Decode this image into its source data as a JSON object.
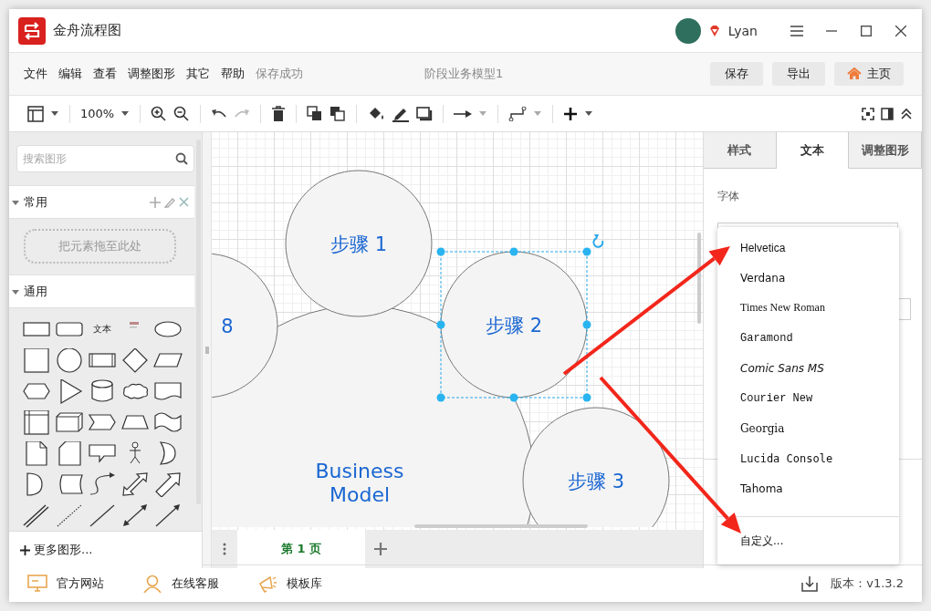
{
  "app": {
    "title": "金舟流程图",
    "user": "Lyan"
  },
  "menu": [
    {
      "label": "文件"
    },
    {
      "label": "编辑"
    },
    {
      "label": "查看"
    },
    {
      "label": "调整图形"
    },
    {
      "label": "其它"
    },
    {
      "label": "帮助"
    }
  ],
  "save_status": "保存成功",
  "document_title": "阶段业务模型1",
  "header_buttons": [
    {
      "label": "保存",
      "kind": "plain"
    },
    {
      "label": "导出",
      "kind": "plain"
    },
    {
      "label": "主页",
      "kind": "home"
    }
  ],
  "toolbar": {
    "zoom": "100%",
    "redo_disabled": true
  },
  "sidebar": {
    "search": {
      "placeholder": "搜索图形"
    },
    "sections": [
      {
        "title": "常用",
        "expanded": true,
        "kind": "favorites",
        "drop_hint": "把元素拖至此处"
      },
      {
        "title": "通用",
        "expanded": true,
        "kind": "shapes",
        "text_shape": "文本"
      }
    ],
    "more_shapes": "更多图形..."
  },
  "canvas": {
    "nodes": [
      {
        "kind": "hub",
        "lines": [
          "Business",
          "Model"
        ],
        "selected": false
      },
      {
        "kind": "step",
        "lines": [
          "8"
        ],
        "selected": false
      },
      {
        "kind": "step",
        "lines": [
          "步骤 1"
        ],
        "selected": false
      },
      {
        "kind": "step",
        "lines": [
          "步骤 2"
        ],
        "selected": true
      },
      {
        "kind": "step",
        "lines": [
          "步骤 3"
        ],
        "selected": false
      }
    ]
  },
  "page_tabs": [
    {
      "label": "第 1 页",
      "selected": true
    }
  ],
  "panel": {
    "tabs": [
      {
        "label": "样式",
        "selected": false
      },
      {
        "label": "文本",
        "selected": true
      },
      {
        "label": "调整图形",
        "selected": false
      }
    ],
    "font_label": "字体",
    "font_menu": {
      "options": [
        {
          "label": "Helvetica",
          "kind": "sans"
        },
        {
          "label": "Verdana",
          "kind": "wide"
        },
        {
          "label": "Times New Roman",
          "kind": "serif"
        },
        {
          "label": "Garamond",
          "kind": "mono"
        },
        {
          "label": "Comic Sans MS",
          "kind": "italic"
        },
        {
          "label": "Courier New",
          "kind": "mono"
        },
        {
          "label": "Georgia",
          "kind": "serif2"
        },
        {
          "label": "Lucida Console",
          "kind": "mono2"
        },
        {
          "label": "Tahoma",
          "kind": "wide"
        }
      ],
      "custom": "自定义..."
    }
  },
  "status_bar": {
    "links": [
      {
        "label": "官方网站",
        "kind": "website"
      },
      {
        "label": "在线客服",
        "kind": "support"
      },
      {
        "label": "模板库",
        "kind": "templates"
      }
    ],
    "version": "版本：v1.3.2"
  }
}
